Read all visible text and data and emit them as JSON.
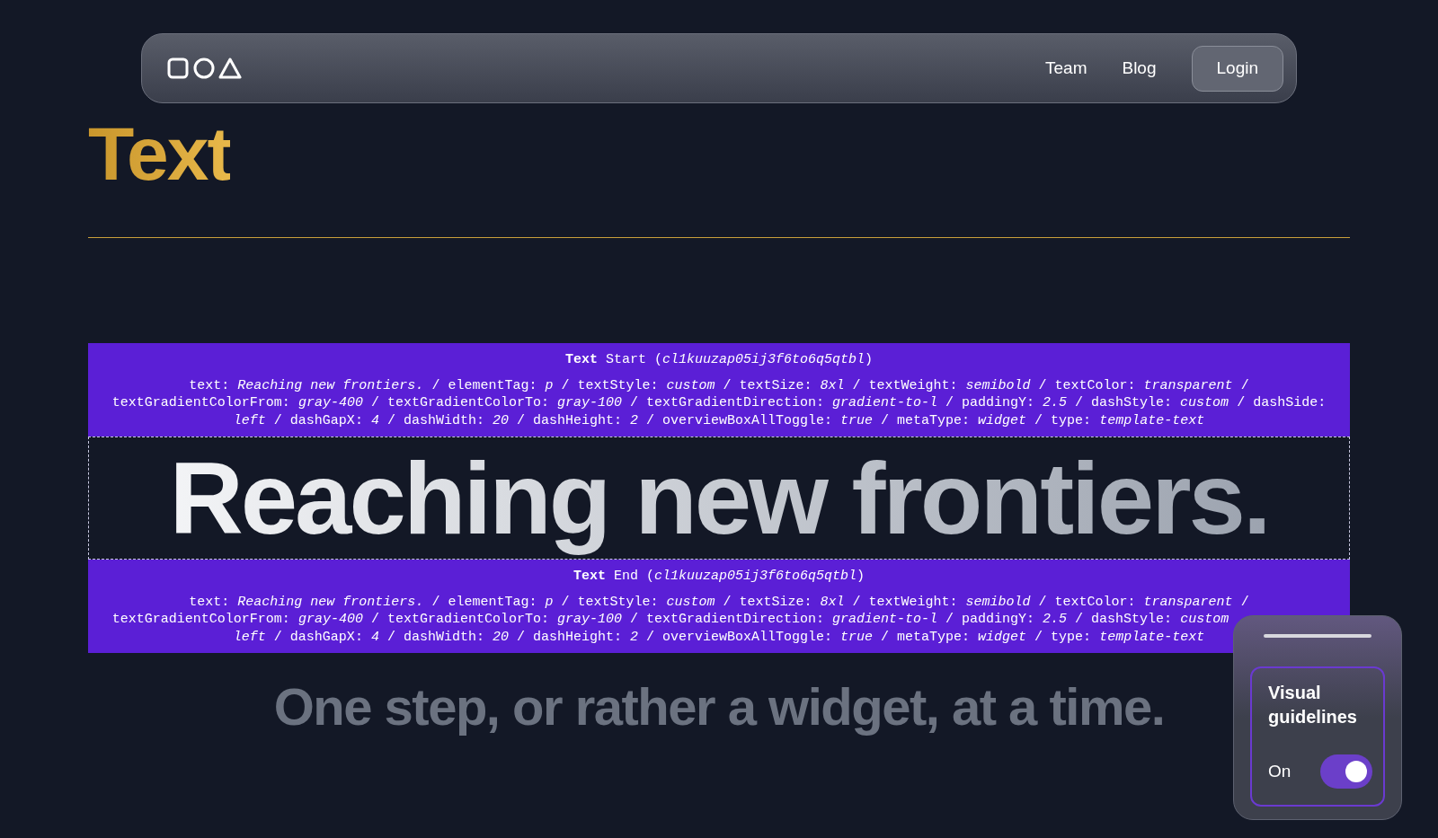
{
  "nav": {
    "links": [
      "Team",
      "Blog"
    ],
    "login": "Login"
  },
  "page_title": "Text",
  "start_box": {
    "heading": "**Text** Start (*cl1kuuzap05ij3f6to6q5qtbl*)",
    "meta_lines": [
      "text: *Reaching new frontiers.* / elementTag: *p* / textStyle: *custom* / textSize: *8xl* / textWeight: *semibold* / textColor: *transparent* /",
      "textGradientColorFrom: *gray-400* / textGradientColorTo: *gray-100* / textGradientDirection: *gradient-to-l* / paddingY: *2.5* / dashStyle: *custom* / dashSide:",
      "*left* / dashGapX: *4* / dashWidth: *20* / dashHeight: *2* / overviewBoxAllToggle: *true* / metaType: *widget* / type: *template-text*"
    ]
  },
  "headline": "Reaching new frontiers.",
  "end_box": {
    "heading": "**Text** End (*cl1kuuzap05ij3f6to6q5qtbl*)",
    "meta_lines": [
      "text: *Reaching new frontiers.* / elementTag: *p* / textStyle: *custom* / textSize: *8xl* / textWeight: *semibold* / textColor: *transparent* /",
      "textGradientColorFrom: *gray-400* / textGradientColorTo: *gray-100* / textGradientDirection: *gradient-to-l* / paddingY: *2.5* / dashStyle: *custom*",
      "*left* / dashGapX: *4* / dashWidth: *20* / dashHeight: *2* / overviewBoxAllToggle: *true* / metaType: *widget* / type: *template-text*"
    ]
  },
  "subtitle": "One step, or rather a widget, at a time.",
  "panel": {
    "title": "Visual guidelines",
    "toggle": {
      "label": "On",
      "on": true
    }
  }
}
